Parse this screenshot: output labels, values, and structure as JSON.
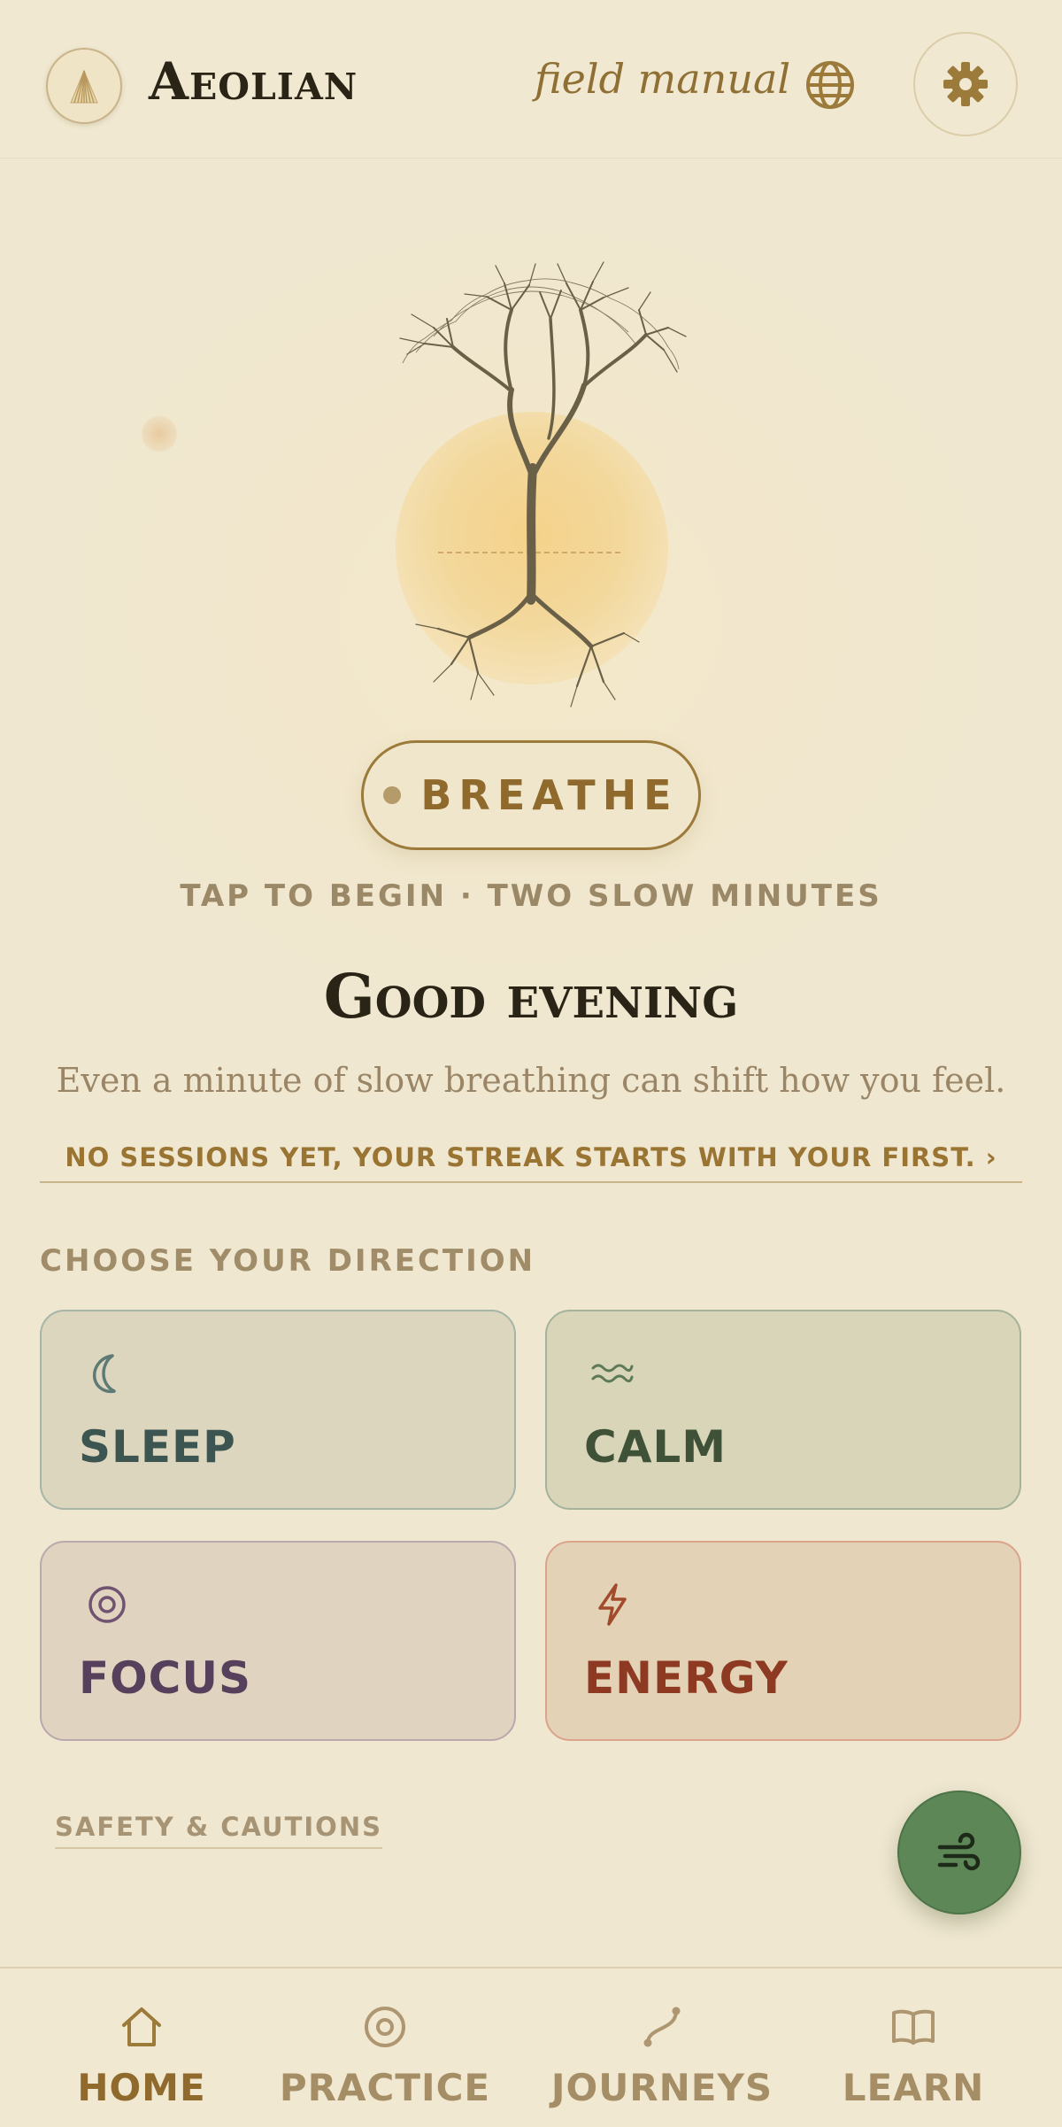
{
  "header": {
    "brand": "Aeolian",
    "subtitle": "field manual"
  },
  "hero": {
    "breathe_label": "BREATHE",
    "tap_hint": "TAP TO BEGIN · TWO SLOW MINUTES",
    "greeting": "Good evening",
    "message": "Even a minute of slow breathing can shift how you feel.",
    "streak": "NO SESSIONS YET, YOUR STREAK STARTS WITH YOUR FIRST. ›"
  },
  "directions": {
    "heading": "CHOOSE YOUR DIRECTION",
    "cards": [
      {
        "label": "SLEEP",
        "icon": "moon-icon",
        "color": "#3d5550"
      },
      {
        "label": "CALM",
        "icon": "waves-icon",
        "color": "#3f5238"
      },
      {
        "label": "FOCUS",
        "icon": "target-icon",
        "color": "#56405b"
      },
      {
        "label": "ENERGY",
        "icon": "lightning-icon",
        "color": "#8e3a22"
      }
    ]
  },
  "footer": {
    "safety_link": "SAFETY & CAUTIONS"
  },
  "nav": {
    "items": [
      {
        "label": "HOME",
        "icon": "home-icon",
        "active": true
      },
      {
        "label": "PRACTICE",
        "icon": "target-icon",
        "active": false
      },
      {
        "label": "JOURNEYS",
        "icon": "path-icon",
        "active": false
      },
      {
        "label": "LEARN",
        "icon": "book-icon",
        "active": false
      }
    ]
  },
  "colors": {
    "background": "#efe7d0",
    "accent": "#8f6a2c",
    "fab": "#5e8757",
    "sun": "#f4d28a"
  }
}
